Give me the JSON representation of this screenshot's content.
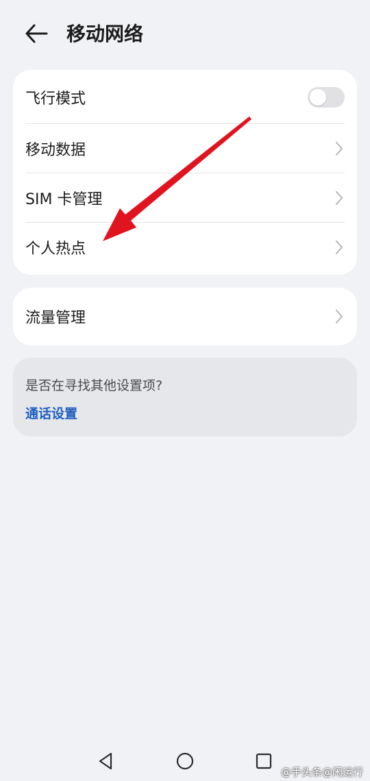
{
  "header": {
    "title": "移动网络",
    "back_icon": "arrow-left-icon"
  },
  "network_card": {
    "airplane_mode": {
      "label": "飞行模式",
      "toggle_on": false
    },
    "items": [
      {
        "label": "移动数据"
      },
      {
        "label": "SIM 卡管理"
      },
      {
        "label": "个人热点"
      }
    ]
  },
  "data_card": {
    "label": "流量管理"
  },
  "suggestion": {
    "question": "是否在寻找其他设置项?",
    "link": "通话设置"
  },
  "annotation": {
    "arrow_color": "#e0141e",
    "target": "个人热点"
  },
  "nav_bar": {
    "back_icon": "triangle-back-icon",
    "home_icon": "circle-home-icon",
    "recents_icon": "square-recents-icon"
  },
  "watermark": {
    "text": "@手头条@闲运行"
  },
  "colors": {
    "background": "#f1f2f6",
    "card": "#ffffff",
    "link": "#1f5fbf"
  }
}
